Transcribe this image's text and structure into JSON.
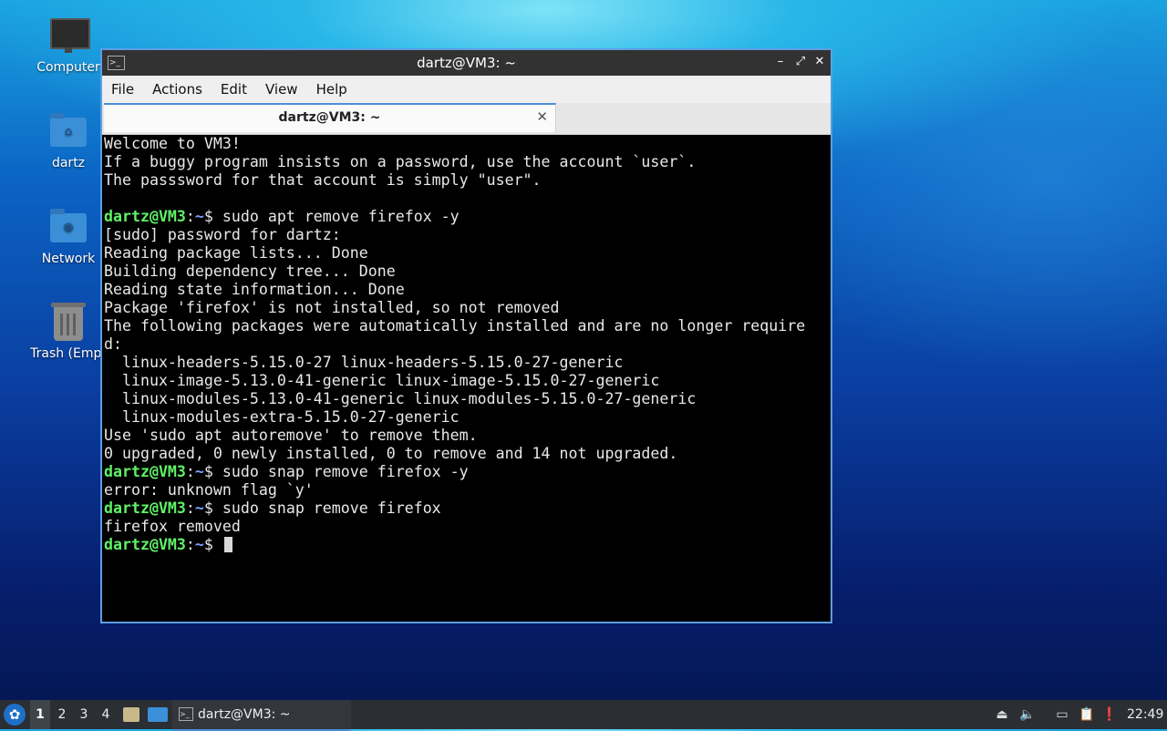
{
  "desktop": {
    "icons": [
      {
        "label": "Computer"
      },
      {
        "label": "dartz"
      },
      {
        "label": "Network"
      },
      {
        "label": "Trash (Empt"
      }
    ]
  },
  "window": {
    "title": "dartz@VM3: ~",
    "minimize": "–",
    "maximize": "⤢",
    "close": "✕",
    "menu": [
      "File",
      "Actions",
      "Edit",
      "View",
      "Help"
    ],
    "tab": {
      "label": "dartz@VM3: ~",
      "close": "✕"
    }
  },
  "terminal": {
    "prompt_user": "dartz@VM3",
    "prompt_path": "~",
    "lines": [
      {
        "t": "Welcome to VM3!"
      },
      {
        "t": "If a buggy program insists on a password, use the account `user`."
      },
      {
        "t": "The passsword for that account is simply \"user\"."
      },
      {
        "t": ""
      },
      {
        "cmd": "sudo apt remove firefox -y"
      },
      {
        "t": "[sudo] password for dartz:"
      },
      {
        "t": "Reading package lists... Done"
      },
      {
        "t": "Building dependency tree... Done"
      },
      {
        "t": "Reading state information... Done"
      },
      {
        "t": "Package 'firefox' is not installed, so not removed"
      },
      {
        "t": "The following packages were automatically installed and are no longer require"
      },
      {
        "t": "d:"
      },
      {
        "t": "  linux-headers-5.15.0-27 linux-headers-5.15.0-27-generic"
      },
      {
        "t": "  linux-image-5.13.0-41-generic linux-image-5.15.0-27-generic"
      },
      {
        "t": "  linux-modules-5.13.0-41-generic linux-modules-5.15.0-27-generic"
      },
      {
        "t": "  linux-modules-extra-5.15.0-27-generic"
      },
      {
        "t": "Use 'sudo apt autoremove' to remove them."
      },
      {
        "t": "0 upgraded, 0 newly installed, 0 to remove and 14 not upgraded."
      },
      {
        "cmd": "sudo snap remove firefox -y"
      },
      {
        "t": "error: unknown flag `y'"
      },
      {
        "cmd": "sudo snap remove firefox"
      },
      {
        "t": "firefox removed"
      },
      {
        "cmd": ""
      }
    ]
  },
  "taskbar": {
    "workspaces": [
      "1",
      "2",
      "3",
      "4"
    ],
    "task_label": "dartz@VM3: ~",
    "clock": "22:49"
  }
}
